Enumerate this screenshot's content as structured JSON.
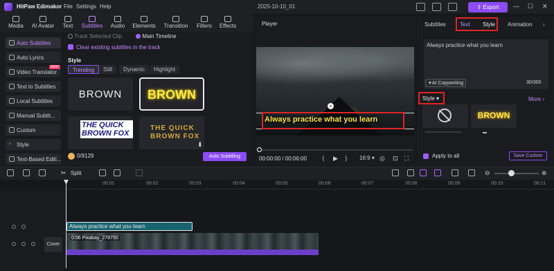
{
  "app": {
    "name": "HitPaw Edimakor",
    "menu": [
      "File",
      "Settings",
      "Help"
    ],
    "project": "2025-10-10_01",
    "export_label": "Export"
  },
  "tool_tabs": [
    {
      "label": "Media"
    },
    {
      "label": "AI Avatar"
    },
    {
      "label": "Text"
    },
    {
      "label": "Subtitles"
    },
    {
      "label": "Audio"
    },
    {
      "label": "Elements"
    },
    {
      "label": "Transition"
    },
    {
      "label": "Filters"
    },
    {
      "label": "Effects"
    }
  ],
  "sidebar": {
    "items": [
      {
        "label": "Auto Subtitles"
      },
      {
        "label": "Auto Lyrics"
      },
      {
        "label": "Video Translator",
        "badge": "NEW"
      },
      {
        "label": "Text to Subtitles"
      },
      {
        "label": "Local Subtitles"
      },
      {
        "label": "Manual Subtit..."
      },
      {
        "label": "Custom"
      },
      {
        "label": "Style"
      },
      {
        "label": "Text-Based Editi..."
      }
    ]
  },
  "subtitles_panel": {
    "track_option": "Track Selected Clip",
    "main_option": "Main Timeline",
    "clear_existing": "Clear existing subtitles in the track",
    "style_heading": "Style",
    "style_tabs": [
      "Trending",
      "Still",
      "Dynamic",
      "Highlight"
    ],
    "cards": [
      "BROWN",
      "BROWN",
      "THE QUICK BROWN FOX",
      "THE QUICK BROWN FOX"
    ],
    "credits": "0/9129",
    "auto_button": "Auto Subtitling"
  },
  "player": {
    "title": "Player",
    "subtitle_text": "Always practice what you learn",
    "timecode": "00:00:00 / 00:06:00",
    "ratio": "16:9"
  },
  "right_panel": {
    "tabs": [
      "Subtitles",
      "Text",
      "Style",
      "Animation"
    ],
    "text_value": "Always practice what you learn",
    "ai_copy": "AI Copywriting",
    "char_count": "30/300",
    "style_dropdown": "Style",
    "more": "More",
    "preset_text": "BROWN",
    "apply_all": "Apply to all",
    "save_custom": "Save Custom"
  },
  "timeline": {
    "split_label": "Split",
    "ticks": [
      "00:01",
      "00:02",
      "00:03",
      "00:04",
      "00:05",
      "00:06",
      "00:07",
      "00:08",
      "00:09",
      "00:10",
      "00:11"
    ],
    "cover_label": "Cover",
    "subtitle_clip": "Always practice what you learn",
    "video_clip": "0:06  Pixabay_278750"
  },
  "colors": {
    "accent": "#8c4cf5",
    "highlight_red": "#e02525",
    "subtitle_yellow": "#ffe94a",
    "subtitle_track": "#17646f",
    "audio_track": "#6b3fc9"
  }
}
